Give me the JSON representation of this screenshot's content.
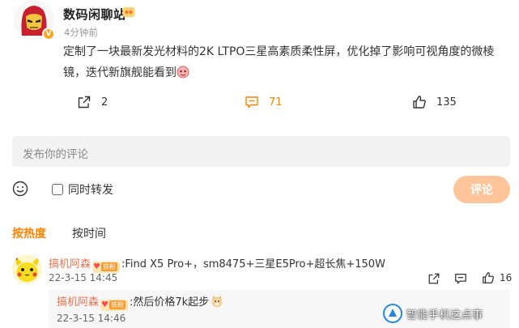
{
  "post": {
    "author": "数码闲聊站",
    "time": "4分钟前",
    "text": "定制了一块最新发光材料的2K LTPO三星高素质柔性屏，优化掉了影响可视角度的微棱镜，迭代新旗舰能看到",
    "shares": "2",
    "comments": "71",
    "likes": "135"
  },
  "composer": {
    "placeholder": "发布你的评论",
    "repost_label": "同时转发",
    "submit_label": "评论"
  },
  "sort_tabs": {
    "hot": "按热度",
    "time": "按时间"
  },
  "comments": [
    {
      "author": "搞机阿森",
      "badge": "铁粉",
      "text": ":Find X5 Pro+，sm8475+三星E5Pro+超长焦+150W",
      "date": "22-3-15 14:45",
      "likes": "16",
      "reply": {
        "author": "搞机阿森",
        "badge": "铁粉",
        "text": ":然后价格7k起步",
        "date": "22-3-15 14:46"
      }
    }
  ],
  "watermark": "智能手机这点事",
  "colors": {
    "accent": "#ff8200",
    "name": "#eb7350",
    "button_disabled": "#ffc59a",
    "input_bg": "#f2f2f2"
  }
}
